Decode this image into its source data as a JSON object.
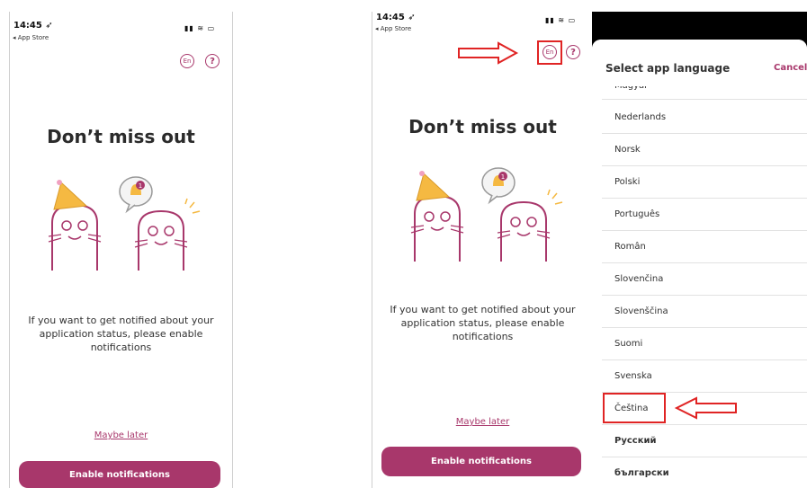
{
  "left": {
    "status": {
      "time": "14:45 ➶",
      "back": "◂ App Store",
      "icons": "▮▮ ≋ ▭"
    },
    "header": {
      "lang": "En",
      "help": "?"
    },
    "title": "Don’t miss out",
    "body": "If you want to get notified about your application status, please enable notifications",
    "maybe_later": "Maybe later",
    "enable_button": "Enable notifications",
    "bell_badge": "1"
  },
  "right": {
    "status": {
      "time": "14:45 ➶",
      "back": "◂ App Store",
      "icons": "▮▮ ≋ ▭"
    },
    "header": {
      "lang": "En",
      "help": "?"
    },
    "title": "Don’t miss out",
    "body": "If you want to get notified about your application status, please enable notifications",
    "maybe_later": "Maybe later",
    "enable_button": "Enable notifications",
    "bell_badge": "1"
  },
  "sheet": {
    "title": "Select app language",
    "cancel": "Cancel",
    "languages": [
      "Magyar",
      "Nederlands",
      "Norsk",
      "Polski",
      "Português",
      "Român",
      "Slovenčina",
      "Slovenščina",
      "Suomi",
      "Svenska",
      "Čeština",
      "Русский",
      "български"
    ]
  },
  "colors": {
    "brand": "#a8376b",
    "annotation": "#e02424",
    "hat": "#f5b942"
  }
}
